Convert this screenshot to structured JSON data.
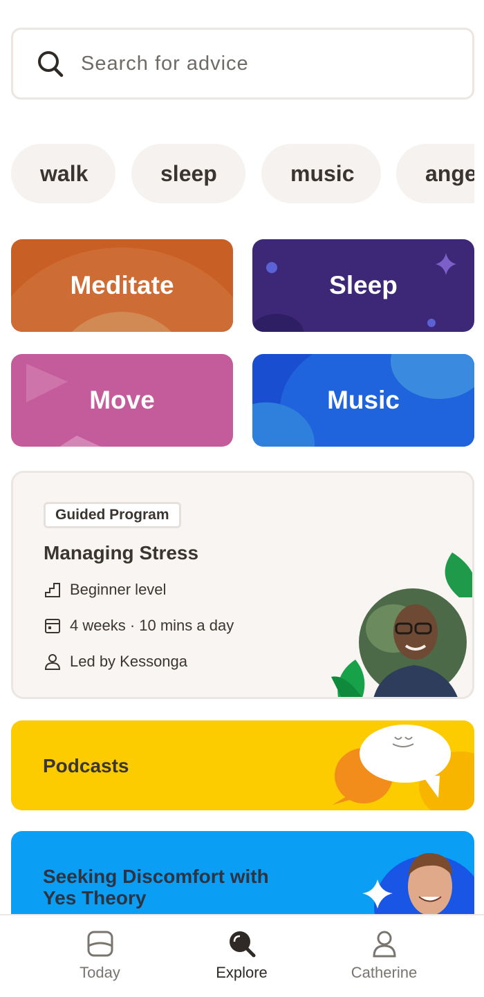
{
  "search": {
    "placeholder": "Search for advice"
  },
  "chips": [
    "walk",
    "sleep",
    "music",
    "ange"
  ],
  "tiles": {
    "meditate": {
      "label": "Meditate",
      "color": "#c85f24"
    },
    "sleep": {
      "label": "Sleep",
      "color": "#3d2878"
    },
    "move": {
      "label": "Move",
      "color": "#c45b9a"
    },
    "music": {
      "label": "Music",
      "color": "#1a4ed1"
    }
  },
  "program": {
    "badge": "Guided Program",
    "title": "Managing Stress",
    "level": "Beginner level",
    "duration": "4 weeks · 10 mins a day",
    "leader": "Led by Kessonga"
  },
  "podcasts": {
    "label": "Podcasts",
    "color": "#fccb00"
  },
  "feature": {
    "title": "Seeking Discomfort with Yes Theory",
    "color": "#0a9ef5"
  },
  "tabs": [
    {
      "label": "Today",
      "icon": "today-icon"
    },
    {
      "label": "Explore",
      "icon": "explore-icon",
      "active": true
    },
    {
      "label": "Catherine",
      "icon": "profile-icon"
    }
  ]
}
